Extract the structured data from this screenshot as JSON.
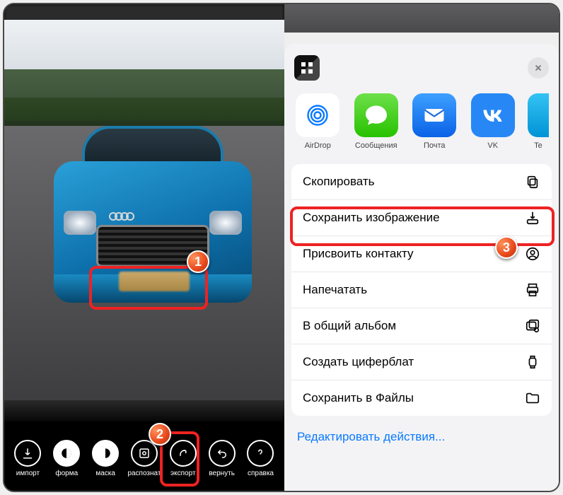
{
  "callouts": {
    "one": "1",
    "two": "2",
    "three": "3"
  },
  "toolbar": {
    "import": "импорт",
    "shape": "форма",
    "mask": "маска",
    "recognize": "распознат",
    "export": "экспорт",
    "undo": "вернуть",
    "help": "справка"
  },
  "share": {
    "airdrop": "AirDrop",
    "messages": "Сообщения",
    "mail": "Почта",
    "vk": "VK",
    "telegram": "Te"
  },
  "actions": {
    "copy": "Скопировать",
    "save_image": "Сохранить изображение",
    "assign_contact": "Присвоить контакту",
    "print": "Напечатать",
    "shared_album": "В общий альбом",
    "watchface": "Создать циферблат",
    "save_files": "Сохранить в Файлы"
  },
  "edit_actions": "Редактировать действия..."
}
